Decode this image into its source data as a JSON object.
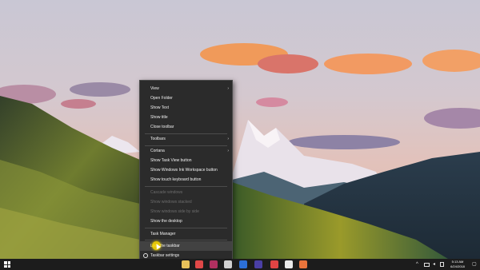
{
  "context_menu": {
    "items": [
      {
        "label": "View",
        "submenu": true,
        "disabled": false
      },
      {
        "label": "Open Folder",
        "submenu": false,
        "disabled": false
      },
      {
        "label": "Show Text",
        "submenu": false,
        "disabled": false
      },
      {
        "label": "Show title",
        "submenu": false,
        "disabled": false
      },
      {
        "label": "Close toolbar",
        "submenu": false,
        "disabled": false
      },
      {
        "label": "Toolbars",
        "submenu": true,
        "disabled": false
      },
      {
        "label": "Cortana",
        "submenu": true,
        "disabled": false
      },
      {
        "label": "Show Task View button",
        "submenu": false,
        "disabled": false
      },
      {
        "label": "Show Windows Ink Workspace button",
        "submenu": false,
        "disabled": false
      },
      {
        "label": "Show touch keyboard button",
        "submenu": false,
        "disabled": false
      },
      {
        "label": "Cascade windows",
        "submenu": false,
        "disabled": true
      },
      {
        "label": "Show windows stacked",
        "submenu": false,
        "disabled": true
      },
      {
        "label": "Show windows side by side",
        "submenu": false,
        "disabled": true
      },
      {
        "label": "Show the desktop",
        "submenu": false,
        "disabled": false
      },
      {
        "label": "Task Manager",
        "submenu": false,
        "disabled": false
      },
      {
        "label": "Lock the taskbar",
        "submenu": false,
        "disabled": false
      },
      {
        "label": "Taskbar settings",
        "submenu": false,
        "disabled": false
      }
    ],
    "arrow_glyph": "›"
  },
  "taskbar": {
    "clock_time": "5:13 AM",
    "clock_date": "6/24/2018",
    "tray_expand_glyph": "^",
    "notification_glyph": "▢",
    "pinned_icons": [
      {
        "name": "file-explorer-icon",
        "color": "#e8c15a"
      },
      {
        "name": "mail-icon",
        "color": "#e04848"
      },
      {
        "name": "media-app-icon",
        "color": "#b03060"
      },
      {
        "name": "window-switch-icon",
        "color": "#d0d0d0"
      },
      {
        "name": "photoshop-icon",
        "color": "#2c6fd6"
      },
      {
        "name": "premiere-icon",
        "color": "#4a3fa5"
      },
      {
        "name": "chrome-icon",
        "color": "#e04444"
      },
      {
        "name": "yandex-icon",
        "color": "#eaeaea"
      },
      {
        "name": "camtasia-icon",
        "color": "#e9743b"
      }
    ]
  }
}
